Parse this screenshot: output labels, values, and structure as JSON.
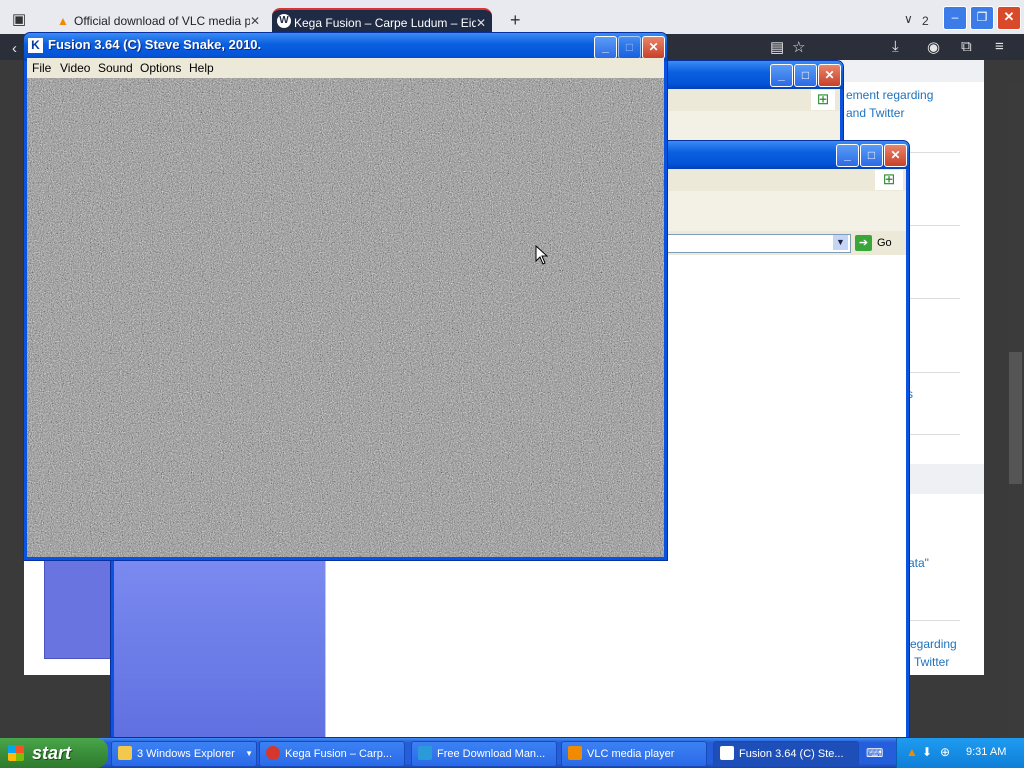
{
  "browser": {
    "tabs": [
      {
        "label": "Official download of VLC media pl",
        "close": "✕"
      },
      {
        "label": "Kega Fusion – Carpe Ludum – Eidc",
        "close": "✕"
      }
    ],
    "new_tab": "+",
    "tab_count": "2",
    "window_controls": {
      "minimize": "–",
      "maximize": "❐",
      "close": "✕"
    }
  },
  "webpage": {
    "link1_line1": "ement regarding",
    "link1_line2": "and Twitter",
    "link2_line1": "egarding",
    "link2_line2": "Twitter",
    "fragment_s": "s",
    "fragment_ata": "ata\""
  },
  "explorer_back": {
    "controls": {
      "minimize": "_",
      "maximize": "□",
      "close": "✕"
    }
  },
  "explorer_front": {
    "controls": {
      "minimize": "_",
      "maximize": "□",
      "close": "✕"
    },
    "go_label": "Go"
  },
  "fusion": {
    "title": "Fusion 3.64 (C) Steve Snake, 2010.",
    "controls": {
      "minimize": "_",
      "maximize": "□",
      "close": "✕"
    },
    "menu": [
      "File",
      "Video",
      "Sound",
      "Options",
      "Help"
    ]
  },
  "taskbar": {
    "start_label": "start",
    "tasks": [
      {
        "label": "3 Windows Explorer",
        "icon": "folder-icon"
      },
      {
        "label": "Kega Fusion – Carp...",
        "icon": "opera-icon"
      },
      {
        "label": "Free Download Man...",
        "icon": "fdm-icon"
      },
      {
        "label": "VLC media player",
        "icon": "vlc-icon"
      },
      {
        "label": "Fusion 3.64 (C) Ste...",
        "icon": "kega-icon"
      }
    ],
    "clock": "9:31 AM"
  },
  "colors": {
    "xp_blue": "#0a53e0",
    "taskbar_blue": "#245edb",
    "start_green": "#3a8f3a",
    "link_blue": "#1e73be"
  }
}
